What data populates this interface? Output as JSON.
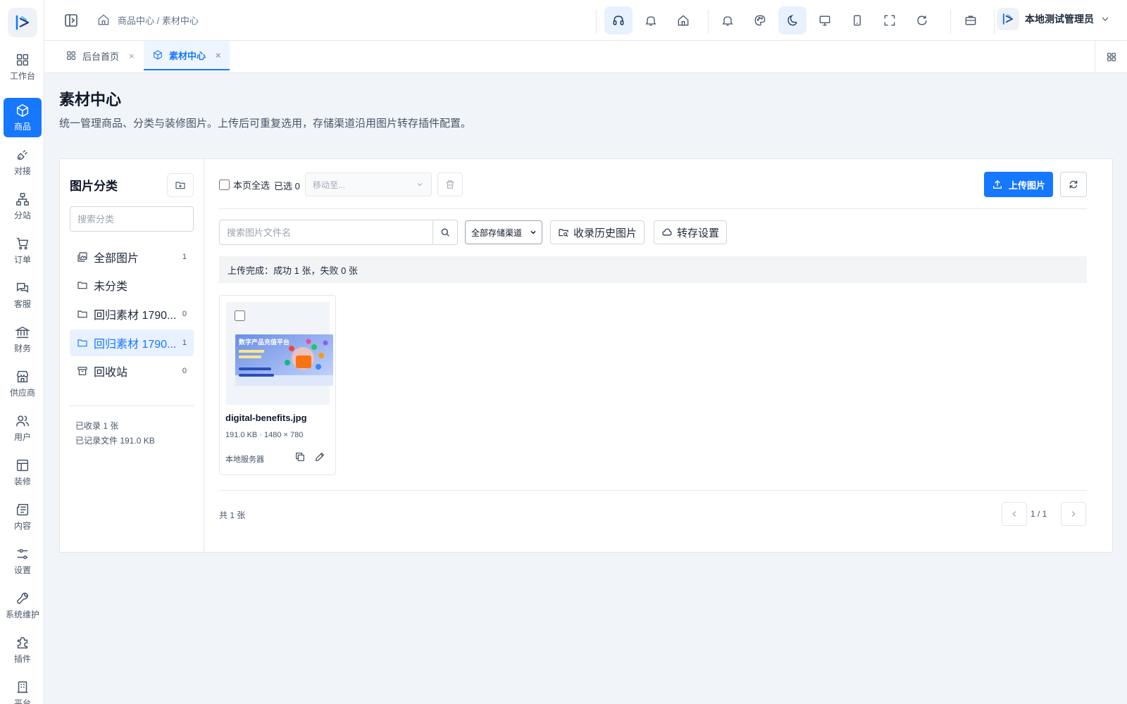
{
  "rail": {
    "items": [
      {
        "label": "工作台",
        "icon": "grid-icon"
      },
      {
        "label": "商品",
        "icon": "cube-icon",
        "active": true
      },
      {
        "label": "对接",
        "icon": "plug-icon"
      },
      {
        "label": "分站",
        "icon": "sitemap-icon"
      },
      {
        "label": "订单",
        "icon": "cart-icon"
      },
      {
        "label": "客服",
        "icon": "chat-icon"
      },
      {
        "label": "财务",
        "icon": "bank-icon"
      },
      {
        "label": "供应商",
        "icon": "store-icon"
      },
      {
        "label": "用户",
        "icon": "users-icon"
      },
      {
        "label": "装修",
        "icon": "layout-icon"
      },
      {
        "label": "内容",
        "icon": "newspaper-icon"
      },
      {
        "label": "设置",
        "icon": "sliders-icon"
      },
      {
        "label": "系统维护",
        "icon": "wrench-icon"
      },
      {
        "label": "插件",
        "icon": "puzzle-icon"
      },
      {
        "label": "平台",
        "icon": "building-icon"
      }
    ]
  },
  "header": {
    "breadcrumb": "商品中心 / 素材中心",
    "user_name": "本地测试管理员",
    "icons": [
      "headset-icon",
      "bell-icon",
      "home-icon",
      "bell-icon",
      "palette-icon",
      "moon-icon",
      "monitor-icon",
      "tablet-icon",
      "fullscreen-icon",
      "refresh-icon",
      "briefcase-icon"
    ]
  },
  "tabs": [
    {
      "label": "后台首页",
      "close": "×"
    },
    {
      "label": "素材中心",
      "close": "×",
      "active": true
    }
  ],
  "page": {
    "title": "素材中心",
    "description": "统一管理商品、分类与装修图片。上传后可重复选用，存储渠道沿用图片转存插件配置。"
  },
  "categories": {
    "title": "图片分类",
    "search_placeholder": "搜索分类",
    "items": [
      {
        "label": "全部图片",
        "count": "1",
        "icon": "images-icon"
      },
      {
        "label": "未分类",
        "count": "",
        "icon": "folder-icon"
      },
      {
        "label": "回归素材 1790...",
        "count": "0",
        "icon": "folder-icon"
      },
      {
        "label": "回归素材 1790...",
        "count": "1",
        "icon": "folder-icon",
        "active": true
      },
      {
        "label": "回收站",
        "count": "0",
        "icon": "archive-icon"
      }
    ],
    "stats": [
      "已收录 1 张",
      "已记录文件 191.0 KB"
    ]
  },
  "toolbar": {
    "select_all_label": "本页全选",
    "selected_label": "已选 0",
    "move_placeholder": "移动至...",
    "upload_label": "上传图片"
  },
  "filters": {
    "search_placeholder": "搜索图片文件名",
    "channel_value": "全部存储渠道",
    "collect_history_label": "收录历史图片",
    "transfer_settings_label": "转存设置"
  },
  "notice": "上传完成：成功 1 张，失败 0 张",
  "images": [
    {
      "filename": "digital-benefits.jpg",
      "meta": "191.0 KB · 1480 × 780",
      "storage": "本地服务器",
      "thumb_title": "数字产品充值平台"
    }
  ],
  "footer": {
    "total": "共 1 张",
    "page": "1 / 1"
  },
  "colors": {
    "accent": "#1677ff",
    "active_bg": "#e8f1ff"
  }
}
